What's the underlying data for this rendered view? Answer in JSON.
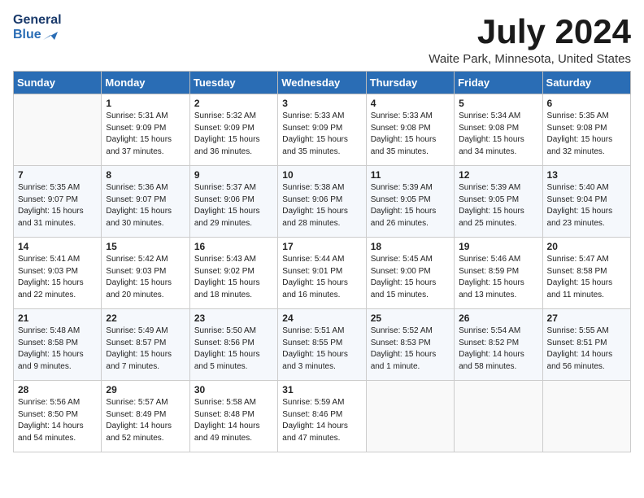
{
  "header": {
    "logo_line1": "General",
    "logo_line2": "Blue",
    "month_title": "July 2024",
    "location": "Waite Park, Minnesota, United States"
  },
  "days_of_week": [
    "Sunday",
    "Monday",
    "Tuesday",
    "Wednesday",
    "Thursday",
    "Friday",
    "Saturday"
  ],
  "weeks": [
    [
      {
        "day": "",
        "sunrise": "",
        "sunset": "",
        "daylight": ""
      },
      {
        "day": "1",
        "sunrise": "Sunrise: 5:31 AM",
        "sunset": "Sunset: 9:09 PM",
        "daylight": "Daylight: 15 hours and 37 minutes."
      },
      {
        "day": "2",
        "sunrise": "Sunrise: 5:32 AM",
        "sunset": "Sunset: 9:09 PM",
        "daylight": "Daylight: 15 hours and 36 minutes."
      },
      {
        "day": "3",
        "sunrise": "Sunrise: 5:33 AM",
        "sunset": "Sunset: 9:09 PM",
        "daylight": "Daylight: 15 hours and 35 minutes."
      },
      {
        "day": "4",
        "sunrise": "Sunrise: 5:33 AM",
        "sunset": "Sunset: 9:08 PM",
        "daylight": "Daylight: 15 hours and 35 minutes."
      },
      {
        "day": "5",
        "sunrise": "Sunrise: 5:34 AM",
        "sunset": "Sunset: 9:08 PM",
        "daylight": "Daylight: 15 hours and 34 minutes."
      },
      {
        "day": "6",
        "sunrise": "Sunrise: 5:35 AM",
        "sunset": "Sunset: 9:08 PM",
        "daylight": "Daylight: 15 hours and 32 minutes."
      }
    ],
    [
      {
        "day": "7",
        "sunrise": "Sunrise: 5:35 AM",
        "sunset": "Sunset: 9:07 PM",
        "daylight": "Daylight: 15 hours and 31 minutes."
      },
      {
        "day": "8",
        "sunrise": "Sunrise: 5:36 AM",
        "sunset": "Sunset: 9:07 PM",
        "daylight": "Daylight: 15 hours and 30 minutes."
      },
      {
        "day": "9",
        "sunrise": "Sunrise: 5:37 AM",
        "sunset": "Sunset: 9:06 PM",
        "daylight": "Daylight: 15 hours and 29 minutes."
      },
      {
        "day": "10",
        "sunrise": "Sunrise: 5:38 AM",
        "sunset": "Sunset: 9:06 PM",
        "daylight": "Daylight: 15 hours and 28 minutes."
      },
      {
        "day": "11",
        "sunrise": "Sunrise: 5:39 AM",
        "sunset": "Sunset: 9:05 PM",
        "daylight": "Daylight: 15 hours and 26 minutes."
      },
      {
        "day": "12",
        "sunrise": "Sunrise: 5:39 AM",
        "sunset": "Sunset: 9:05 PM",
        "daylight": "Daylight: 15 hours and 25 minutes."
      },
      {
        "day": "13",
        "sunrise": "Sunrise: 5:40 AM",
        "sunset": "Sunset: 9:04 PM",
        "daylight": "Daylight: 15 hours and 23 minutes."
      }
    ],
    [
      {
        "day": "14",
        "sunrise": "Sunrise: 5:41 AM",
        "sunset": "Sunset: 9:03 PM",
        "daylight": "Daylight: 15 hours and 22 minutes."
      },
      {
        "day": "15",
        "sunrise": "Sunrise: 5:42 AM",
        "sunset": "Sunset: 9:03 PM",
        "daylight": "Daylight: 15 hours and 20 minutes."
      },
      {
        "day": "16",
        "sunrise": "Sunrise: 5:43 AM",
        "sunset": "Sunset: 9:02 PM",
        "daylight": "Daylight: 15 hours and 18 minutes."
      },
      {
        "day": "17",
        "sunrise": "Sunrise: 5:44 AM",
        "sunset": "Sunset: 9:01 PM",
        "daylight": "Daylight: 15 hours and 16 minutes."
      },
      {
        "day": "18",
        "sunrise": "Sunrise: 5:45 AM",
        "sunset": "Sunset: 9:00 PM",
        "daylight": "Daylight: 15 hours and 15 minutes."
      },
      {
        "day": "19",
        "sunrise": "Sunrise: 5:46 AM",
        "sunset": "Sunset: 8:59 PM",
        "daylight": "Daylight: 15 hours and 13 minutes."
      },
      {
        "day": "20",
        "sunrise": "Sunrise: 5:47 AM",
        "sunset": "Sunset: 8:58 PM",
        "daylight": "Daylight: 15 hours and 11 minutes."
      }
    ],
    [
      {
        "day": "21",
        "sunrise": "Sunrise: 5:48 AM",
        "sunset": "Sunset: 8:58 PM",
        "daylight": "Daylight: 15 hours and 9 minutes."
      },
      {
        "day": "22",
        "sunrise": "Sunrise: 5:49 AM",
        "sunset": "Sunset: 8:57 PM",
        "daylight": "Daylight: 15 hours and 7 minutes."
      },
      {
        "day": "23",
        "sunrise": "Sunrise: 5:50 AM",
        "sunset": "Sunset: 8:56 PM",
        "daylight": "Daylight: 15 hours and 5 minutes."
      },
      {
        "day": "24",
        "sunrise": "Sunrise: 5:51 AM",
        "sunset": "Sunset: 8:55 PM",
        "daylight": "Daylight: 15 hours and 3 minutes."
      },
      {
        "day": "25",
        "sunrise": "Sunrise: 5:52 AM",
        "sunset": "Sunset: 8:53 PM",
        "daylight": "Daylight: 15 hours and 1 minute."
      },
      {
        "day": "26",
        "sunrise": "Sunrise: 5:54 AM",
        "sunset": "Sunset: 8:52 PM",
        "daylight": "Daylight: 14 hours and 58 minutes."
      },
      {
        "day": "27",
        "sunrise": "Sunrise: 5:55 AM",
        "sunset": "Sunset: 8:51 PM",
        "daylight": "Daylight: 14 hours and 56 minutes."
      }
    ],
    [
      {
        "day": "28",
        "sunrise": "Sunrise: 5:56 AM",
        "sunset": "Sunset: 8:50 PM",
        "daylight": "Daylight: 14 hours and 54 minutes."
      },
      {
        "day": "29",
        "sunrise": "Sunrise: 5:57 AM",
        "sunset": "Sunset: 8:49 PM",
        "daylight": "Daylight: 14 hours and 52 minutes."
      },
      {
        "day": "30",
        "sunrise": "Sunrise: 5:58 AM",
        "sunset": "Sunset: 8:48 PM",
        "daylight": "Daylight: 14 hours and 49 minutes."
      },
      {
        "day": "31",
        "sunrise": "Sunrise: 5:59 AM",
        "sunset": "Sunset: 8:46 PM",
        "daylight": "Daylight: 14 hours and 47 minutes."
      },
      {
        "day": "",
        "sunrise": "",
        "sunset": "",
        "daylight": ""
      },
      {
        "day": "",
        "sunrise": "",
        "sunset": "",
        "daylight": ""
      },
      {
        "day": "",
        "sunrise": "",
        "sunset": "",
        "daylight": ""
      }
    ]
  ]
}
